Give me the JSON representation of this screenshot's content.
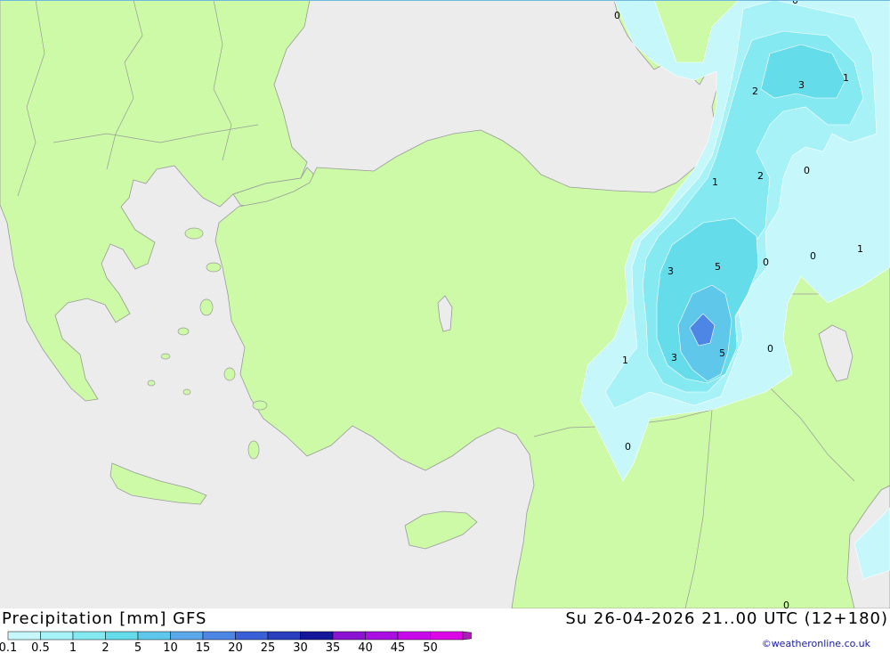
{
  "header": {
    "title": "Precipitation [mm] GFS",
    "datetime": "Su 26-04-2026 21..00 UTC (12+180)",
    "credit": "©weatheronline.co.uk"
  },
  "colors": {
    "sea": "#ececec",
    "land": "#ccfaa6",
    "border": "#9a9a9a"
  },
  "legend": {
    "ticks": [
      "0.1",
      "0.5",
      "1",
      "2",
      "5",
      "10",
      "15",
      "20",
      "25",
      "30",
      "35",
      "40",
      "45",
      "50"
    ],
    "colors": [
      "#c6f7fb",
      "#a6f2f7",
      "#85e9f2",
      "#64dcea",
      "#5fc8ea",
      "#5aa8ea",
      "#4e86e6",
      "#3a5fd6",
      "#2a3fbe",
      "#16169a",
      "#8a14d2",
      "#a90ee2",
      "#c80aea",
      "#dd06e6",
      "#ae1ab8"
    ]
  },
  "contour_labels": [
    "0",
    "0",
    "3",
    "2",
    "1",
    "1",
    "2",
    "0",
    "3",
    "5",
    "0",
    "0",
    "1",
    "1",
    "3",
    "5",
    "0",
    "0",
    "0"
  ]
}
